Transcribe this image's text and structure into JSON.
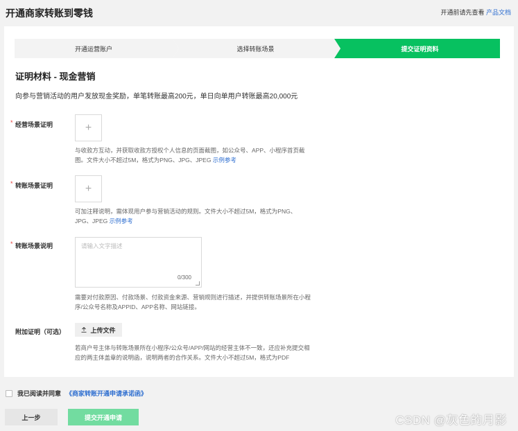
{
  "header": {
    "title": "开通商家转账到零钱",
    "right_text": "开通前请先查看",
    "right_link": "产品文档"
  },
  "steps": [
    {
      "label": "开通运营账户",
      "active": false
    },
    {
      "label": "选择转账场景",
      "active": false
    },
    {
      "label": "提交证明资料",
      "active": true
    }
  ],
  "section": {
    "title": "证明材料 - 现金营销",
    "desc": "向参与营销活动的用户发放现金奖励，单笔转账最高200元，单日向单用户转账最高20,000元"
  },
  "fields": {
    "business_scene": {
      "label": "经营场景证明",
      "required_mark": "*",
      "upload_icon": "+",
      "hint": "与收款方互动，并获取收款方授权个人信息的页面截图，如公众号、APP、小程序首页截图。文件大小不超过5M，格式为PNG、JPG、JPEG",
      "link": "示例参考"
    },
    "transfer_scene": {
      "label": "转账场景证明",
      "required_mark": "*",
      "upload_icon": "+",
      "hint": "可加注释说明，需体现用户参与营销活动的规则。文件大小不超过5M，格式为PNG、JPG、JPEG",
      "link": "示例参考"
    },
    "scene_desc": {
      "label": "转账场景说明",
      "required_mark": "*",
      "placeholder": "请输入文字描述",
      "value": "",
      "counter": "0/300",
      "hint": "需要对付款原因、付款场景、付款资金来源、营销规则进行描述，并提供转账场景所在小程序/公众号名称及APPID、APP名称、网站链接。"
    },
    "extra": {
      "label": "附加证明（可选）",
      "button_icon": "upload-icon",
      "button_label": "上传文件",
      "hint": "若商户号主体与转账场景所在小程序/公众号/APP/网站的经营主体不一致，还应补充提交相应的两主体盖章的说明函，说明两者的合作关系。文件大小不超过5M，格式为PDF"
    }
  },
  "agreement": {
    "text": "我已阅读并同意",
    "link": "《商家转账开通申请承诺函》",
    "checked": false
  },
  "actions": {
    "prev_label": "上一步",
    "submit_label": "提交开通申请"
  },
  "watermark": "CSDN @灰色的月影",
  "colors": {
    "accent": "#07c160",
    "submit_disabled": "#72dca0",
    "link": "#2f6fd0",
    "required": "#e64340"
  }
}
